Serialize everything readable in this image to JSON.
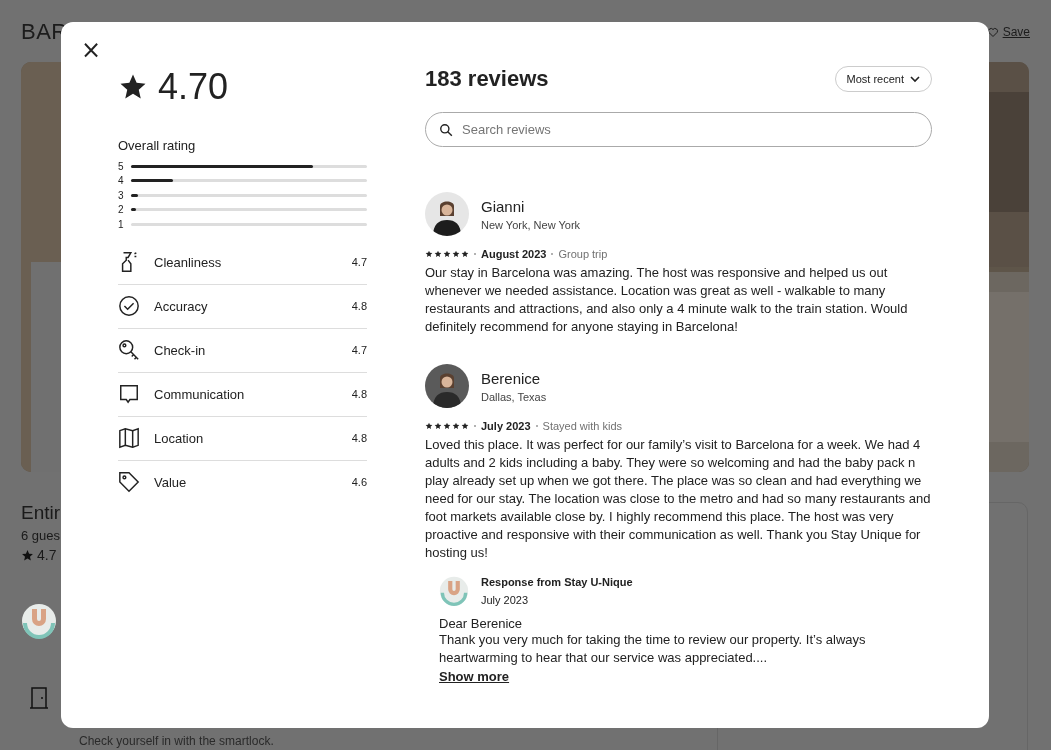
{
  "page": {
    "title": "BAR",
    "save_label": "Save",
    "listing_title": "Entir",
    "guests": "6 gues",
    "rating": "4.7",
    "checkin_note": "Check yourself in with the smartlock."
  },
  "modal": {
    "close": "×",
    "overall_score": "4.70",
    "overall_label": "Overall rating",
    "rating_bars": [
      {
        "label": "5",
        "level": 0.77
      },
      {
        "label": "4",
        "level": 0.18
      },
      {
        "label": "3",
        "level": 0.03
      },
      {
        "label": "2",
        "level": 0.02
      },
      {
        "label": "1"
      }
    ],
    "categories": [
      {
        "kind": "spray",
        "label": "Cleanliness",
        "score": "4.7"
      },
      {
        "kind": "check",
        "label": "Accuracy",
        "score": "4.8"
      },
      {
        "kind": "key",
        "label": "Check-in",
        "score": "4.7"
      },
      {
        "kind": "chat",
        "label": "Communication",
        "score": "4.8"
      },
      {
        "kind": "map",
        "label": "Location",
        "score": "4.8"
      },
      {
        "kind": "tag",
        "label": "Value",
        "score": "4.6"
      }
    ],
    "review_count": "183 reviews",
    "sort": "Most recent",
    "search": {
      "placeholder": "Search reviews"
    },
    "reviews": [
      {
        "name": "Gianni",
        "location": "New York, New York",
        "stars": 5,
        "date": "August 2023",
        "trip": "Group trip",
        "text": "Our stay in Barcelona was amazing. The host was responsive and helped us out whenever we needed assistance. Location was great as well - walkable to many restaurants and attractions, and also only a 4 minute walk to the train station. Would definitely recommend for anyone staying in Barcelona!"
      },
      {
        "name": "Berenice",
        "location": "Dallas, Texas",
        "stars": 5,
        "date": "July 2023",
        "trip": "Stayed with kids",
        "text": "Loved this place. It was perfect for our family’s visit to Barcelona for a week. We had 4 adults and 2 kids including a baby. They were so welcoming and had the baby pack n play already set up when we got there. The place was so clean and had everything we need for our stay. The location was close to the metro and had so many restaurants and foot markets available close by. I highly recommend this place. The host was very proactive and responsive with their communication as well. Thank you Stay Unique for hosting us!",
        "response": {
          "from": "Response from Stay U-Nique",
          "date": "July 2023",
          "greeting": "Dear Berenice",
          "text": "Thank you very much for taking the time to review our property. It’s always heartwarming to hear that our service was appreciated....",
          "link": "Show more"
        }
      }
    ]
  }
}
